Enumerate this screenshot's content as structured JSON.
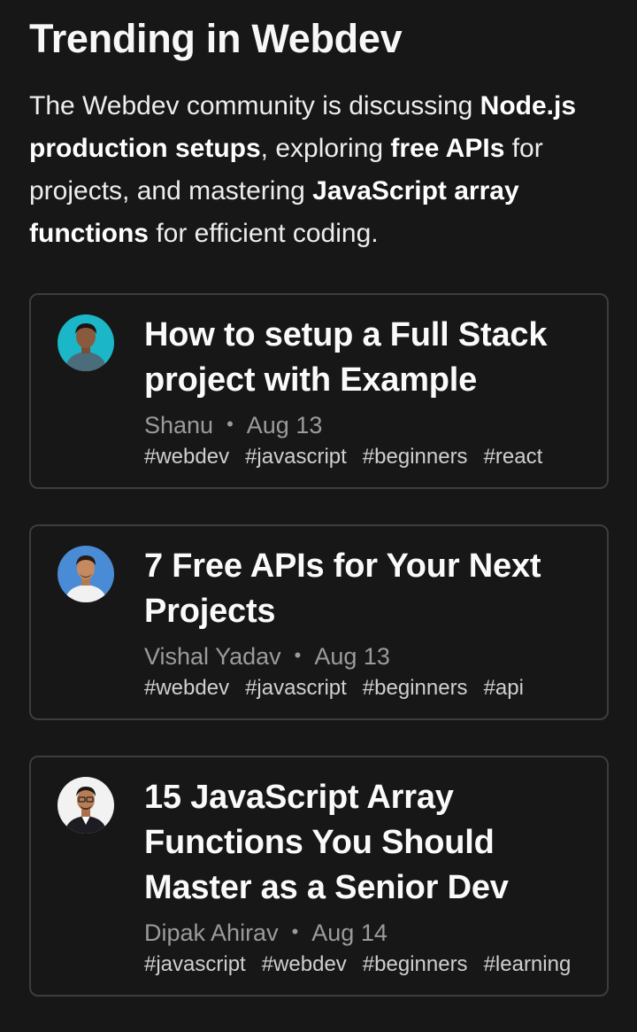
{
  "section": {
    "title": "Trending in Webdev",
    "summary": {
      "p1": "The Webdev community is discussing ",
      "b1": "Node.js production setups",
      "p2": ", exploring ",
      "b2": "free APIs",
      "p3": " for projects, and mastering ",
      "b3": "JavaScript array functions",
      "p4": " for efficient coding."
    }
  },
  "posts": [
    {
      "title": "How to setup a Full Stack project with Example",
      "author": "Shanu",
      "date": "Aug 13",
      "tags": [
        "#webdev",
        "#javascript",
        "#beginners",
        "#react"
      ],
      "avatar_icon": "user-avatar-icon",
      "avatar_bg": "#1bb7c8"
    },
    {
      "title": "7 Free APIs for Your Next Projects",
      "author": "Vishal Yadav",
      "date": "Aug 13",
      "tags": [
        "#webdev",
        "#javascript",
        "#beginners",
        "#api"
      ],
      "avatar_icon": "user-avatar-icon",
      "avatar_bg": "#4a8bd6"
    },
    {
      "title": "15 JavaScript Array Functions You Should Master as a Senior Dev",
      "author": "Dipak Ahirav",
      "date": "Aug 14",
      "tags": [
        "#javascript",
        "#webdev",
        "#beginners",
        "#learning"
      ],
      "avatar_icon": "user-avatar-icon",
      "avatar_bg": "#f2f2f2"
    }
  ],
  "meta_separator": "•"
}
